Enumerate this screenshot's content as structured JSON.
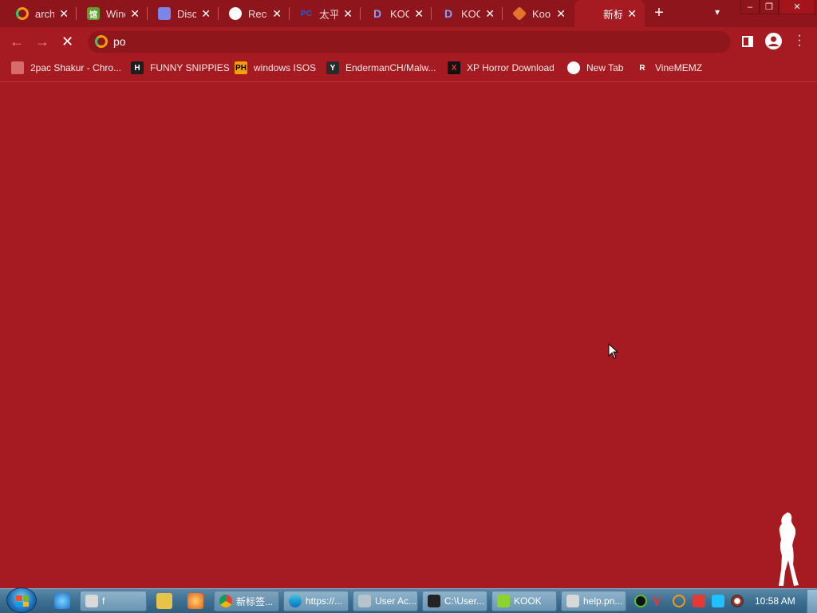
{
  "tabs": [
    {
      "title": "archi",
      "icon": "opera-icon",
      "active": false
    },
    {
      "title": "Wind",
      "icon": "win-icon",
      "active": false
    },
    {
      "title": "Disc",
      "icon": "discord-icon",
      "active": false
    },
    {
      "title": "Rece",
      "icon": "globe-icon",
      "active": false
    },
    {
      "title": "太平",
      "icon": "pc-icon",
      "active": false
    },
    {
      "title": "KOO",
      "icon": "kook-d-icon",
      "active": false
    },
    {
      "title": "KOO",
      "icon": "kook-d-icon",
      "active": false
    },
    {
      "title": "Kool",
      "icon": "kook-diamond-icon",
      "active": false
    },
    {
      "title": "新标",
      "icon": "blank-icon",
      "active": true
    }
  ],
  "omnibox": {
    "value": "po"
  },
  "bookmarks": [
    {
      "label": "2pac Shakur - Chro...",
      "icon": "cake-icon"
    },
    {
      "label": "FUNNY SNIPPIES",
      "icon": "h-icon"
    },
    {
      "label": "windows ISOS",
      "icon": "ph-icon"
    },
    {
      "label": "EndermanCH/Malw...",
      "icon": "y-icon"
    },
    {
      "label": "XP Horror Download",
      "icon": "x-icon"
    },
    {
      "label": "New Tab",
      "icon": "globe-icon"
    },
    {
      "label": "VineMEMZ",
      "icon": "r-icon"
    }
  ],
  "taskbar": {
    "items": [
      {
        "label": "f"
      },
      {
        "label": "新标签..."
      },
      {
        "label": "https://..."
      },
      {
        "label": "User Ac..."
      },
      {
        "label": "C:\\User..."
      },
      {
        "label": "KOOK"
      },
      {
        "label": "help.pn..."
      }
    ],
    "clock": "10:58 AM"
  },
  "colors": {
    "page_bg": "#a61b21",
    "tabstrip_bg": "#8e151b"
  }
}
